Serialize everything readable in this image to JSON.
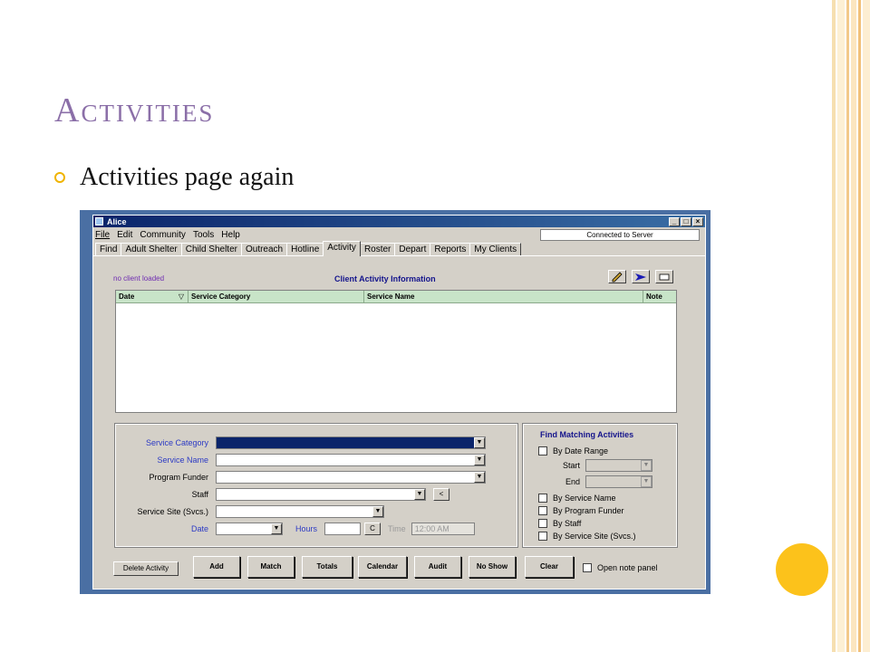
{
  "slide": {
    "title": "Activities",
    "bullet": "Activities page again"
  },
  "window": {
    "title": "Alice",
    "controls": [
      "_",
      "□",
      "×"
    ]
  },
  "menu": [
    "File",
    "Edit",
    "Community",
    "Tools",
    "Help"
  ],
  "status": "Connected to Server",
  "tabs": [
    "Find",
    "Adult Shelter",
    "Child Shelter",
    "Outreach",
    "Hotline",
    "Activity",
    "Roster",
    "Depart",
    "Reports",
    "My Clients"
  ],
  "active_tab": "Activity",
  "panel": {
    "client_status": "no client loaded",
    "heading": "Client Activity Information",
    "tool_icons": [
      "pencil-icon",
      "arrow-right-icon",
      "print-icon"
    ]
  },
  "grid": {
    "columns": [
      "Date",
      "Service Category",
      "Service Name",
      "Note"
    ],
    "sort_indicator": "▽",
    "rows": []
  },
  "form": {
    "service_category": "Service Category",
    "service_name": "Service Name",
    "program_funder": "Program Funder",
    "staff": "Staff",
    "service_site": "Service Site (Svcs.)",
    "date": "Date",
    "hours": "Hours",
    "staff_btn": "<",
    "hours_btn": "C",
    "time_label": "Time",
    "time_value": "12:00 AM"
  },
  "find": {
    "title": "Find Matching Activities",
    "by_date_range": "By Date Range",
    "start": "Start",
    "end": "End",
    "by_service_name": "By Service Name",
    "by_program_funder": "By Program Funder",
    "by_staff": "By Staff",
    "by_service_site": "By Service Site (Svcs.)"
  },
  "buttons": {
    "delete": "Delete Activity",
    "add": "Add",
    "match": "Match",
    "totals": "Totals",
    "calendar": "Calendar",
    "audit": "Audit",
    "no_show": "No Show",
    "clear": "Clear",
    "open_note": "Open note panel"
  },
  "colors": {
    "slide_title": "#8b6fa8",
    "accent_circle": "#fcc21b",
    "frame": "#4a6fa3",
    "window_bg": "#d4d0c8",
    "grid_header": "#c8e4c8"
  }
}
